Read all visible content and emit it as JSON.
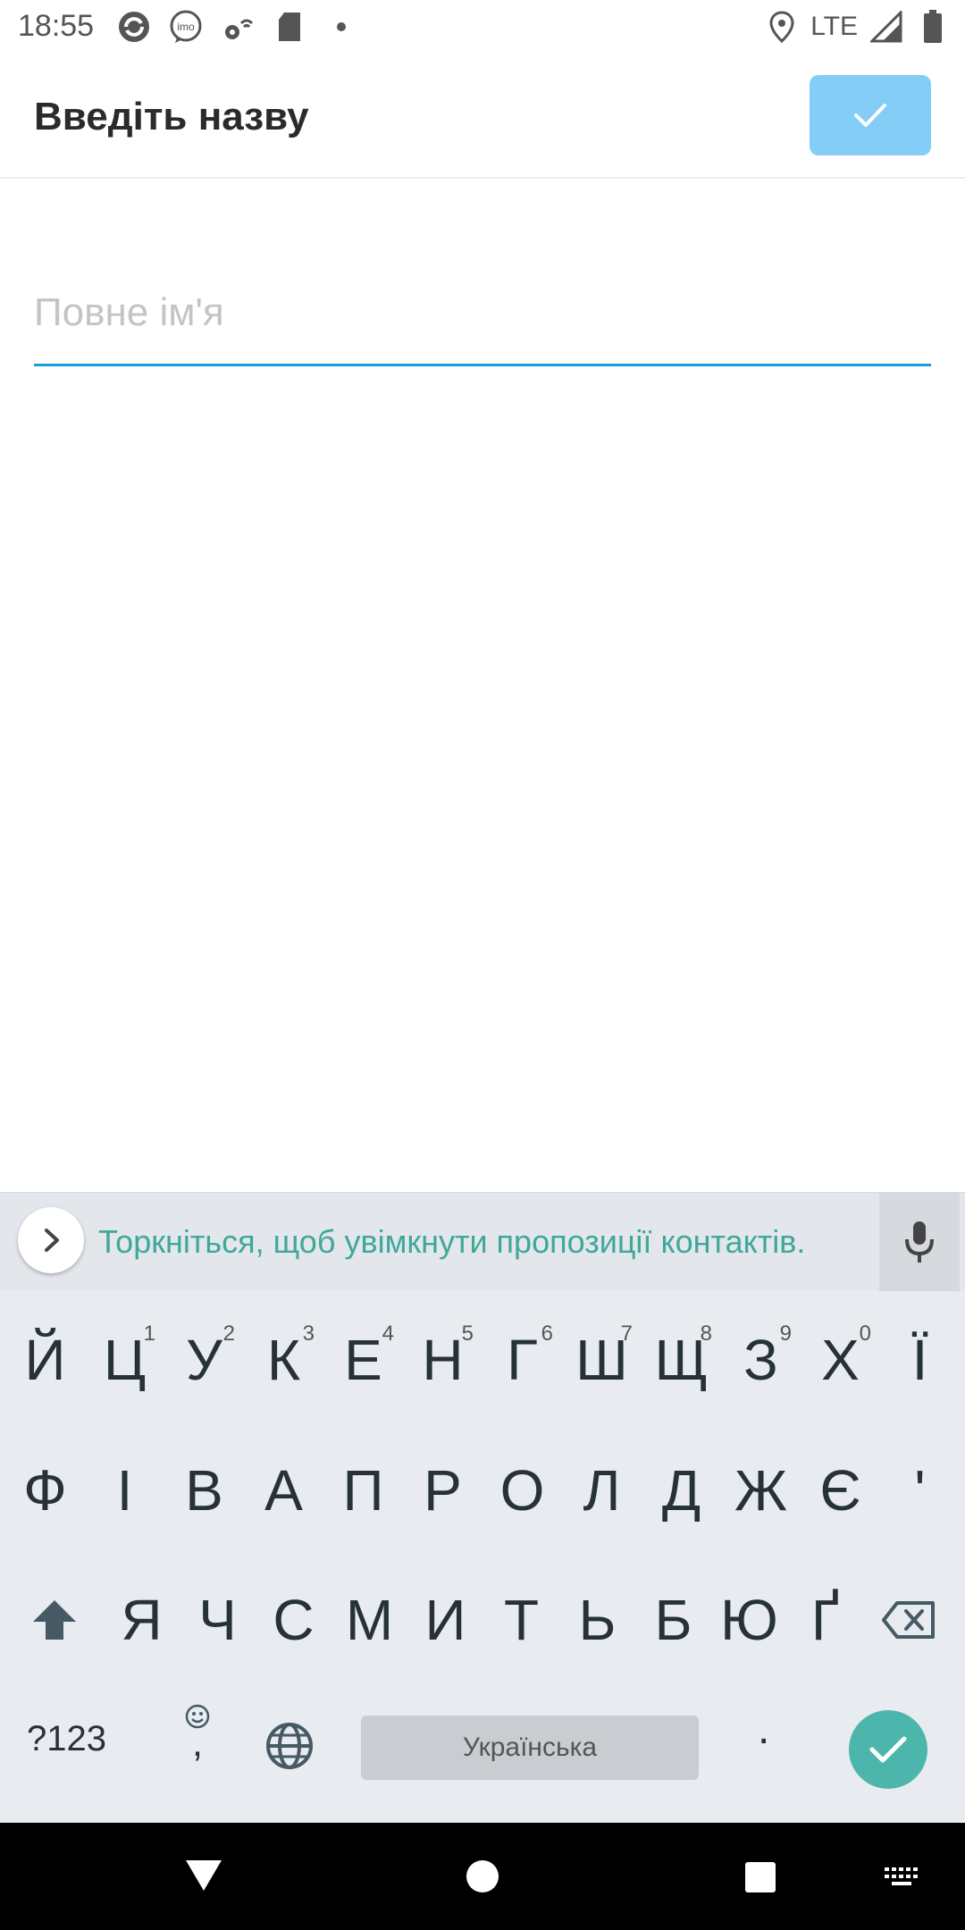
{
  "status_bar": {
    "time": "18:55",
    "left_icons": [
      "sync-icon",
      "imo-icon",
      "settings-wifi-icon",
      "sd-card-icon",
      "dot-icon"
    ],
    "imo_label": "imo",
    "network": "LTE",
    "right_icons": [
      "location-icon",
      "signal-icon",
      "battery-icon"
    ]
  },
  "app_bar": {
    "title": "Введіть назву",
    "confirm_icon": "check-icon",
    "accent": "#83cdf6"
  },
  "form": {
    "name_placeholder": "Повне ім'я",
    "name_value": "",
    "underline_color": "#1aa0d8"
  },
  "keyboard": {
    "suggestion_text": "Торкніться, щоб увімкнути пропозиції контактів.",
    "suggestion_color": "#3fa89b",
    "row1": [
      {
        "k": "Й",
        "h": ""
      },
      {
        "k": "Ц",
        "h": "1"
      },
      {
        "k": "У",
        "h": "2"
      },
      {
        "k": "К",
        "h": "3"
      },
      {
        "k": "Е",
        "h": "4"
      },
      {
        "k": "Н",
        "h": "5"
      },
      {
        "k": "Г",
        "h": "6"
      },
      {
        "k": "Ш",
        "h": "7"
      },
      {
        "k": "Щ",
        "h": "8"
      },
      {
        "k": "З",
        "h": "9"
      },
      {
        "k": "Х",
        "h": "0"
      },
      {
        "k": "Ї",
        "h": ""
      }
    ],
    "row2": [
      "Ф",
      "І",
      "В",
      "А",
      "П",
      "Р",
      "О",
      "Л",
      "Д",
      "Ж",
      "Є",
      "'"
    ],
    "row3": [
      "Я",
      "Ч",
      "С",
      "М",
      "И",
      "Т",
      "Ь",
      "Б",
      "Ю",
      "Ґ"
    ],
    "symbols_label": "?123",
    "comma_label": ",",
    "space_label": "Українська",
    "period_label": ".",
    "enter_color": "#4db6ac"
  },
  "nav_bar": {
    "icons": [
      "back-icon",
      "home-icon",
      "recents-icon",
      "keyboard-switch-icon"
    ]
  }
}
